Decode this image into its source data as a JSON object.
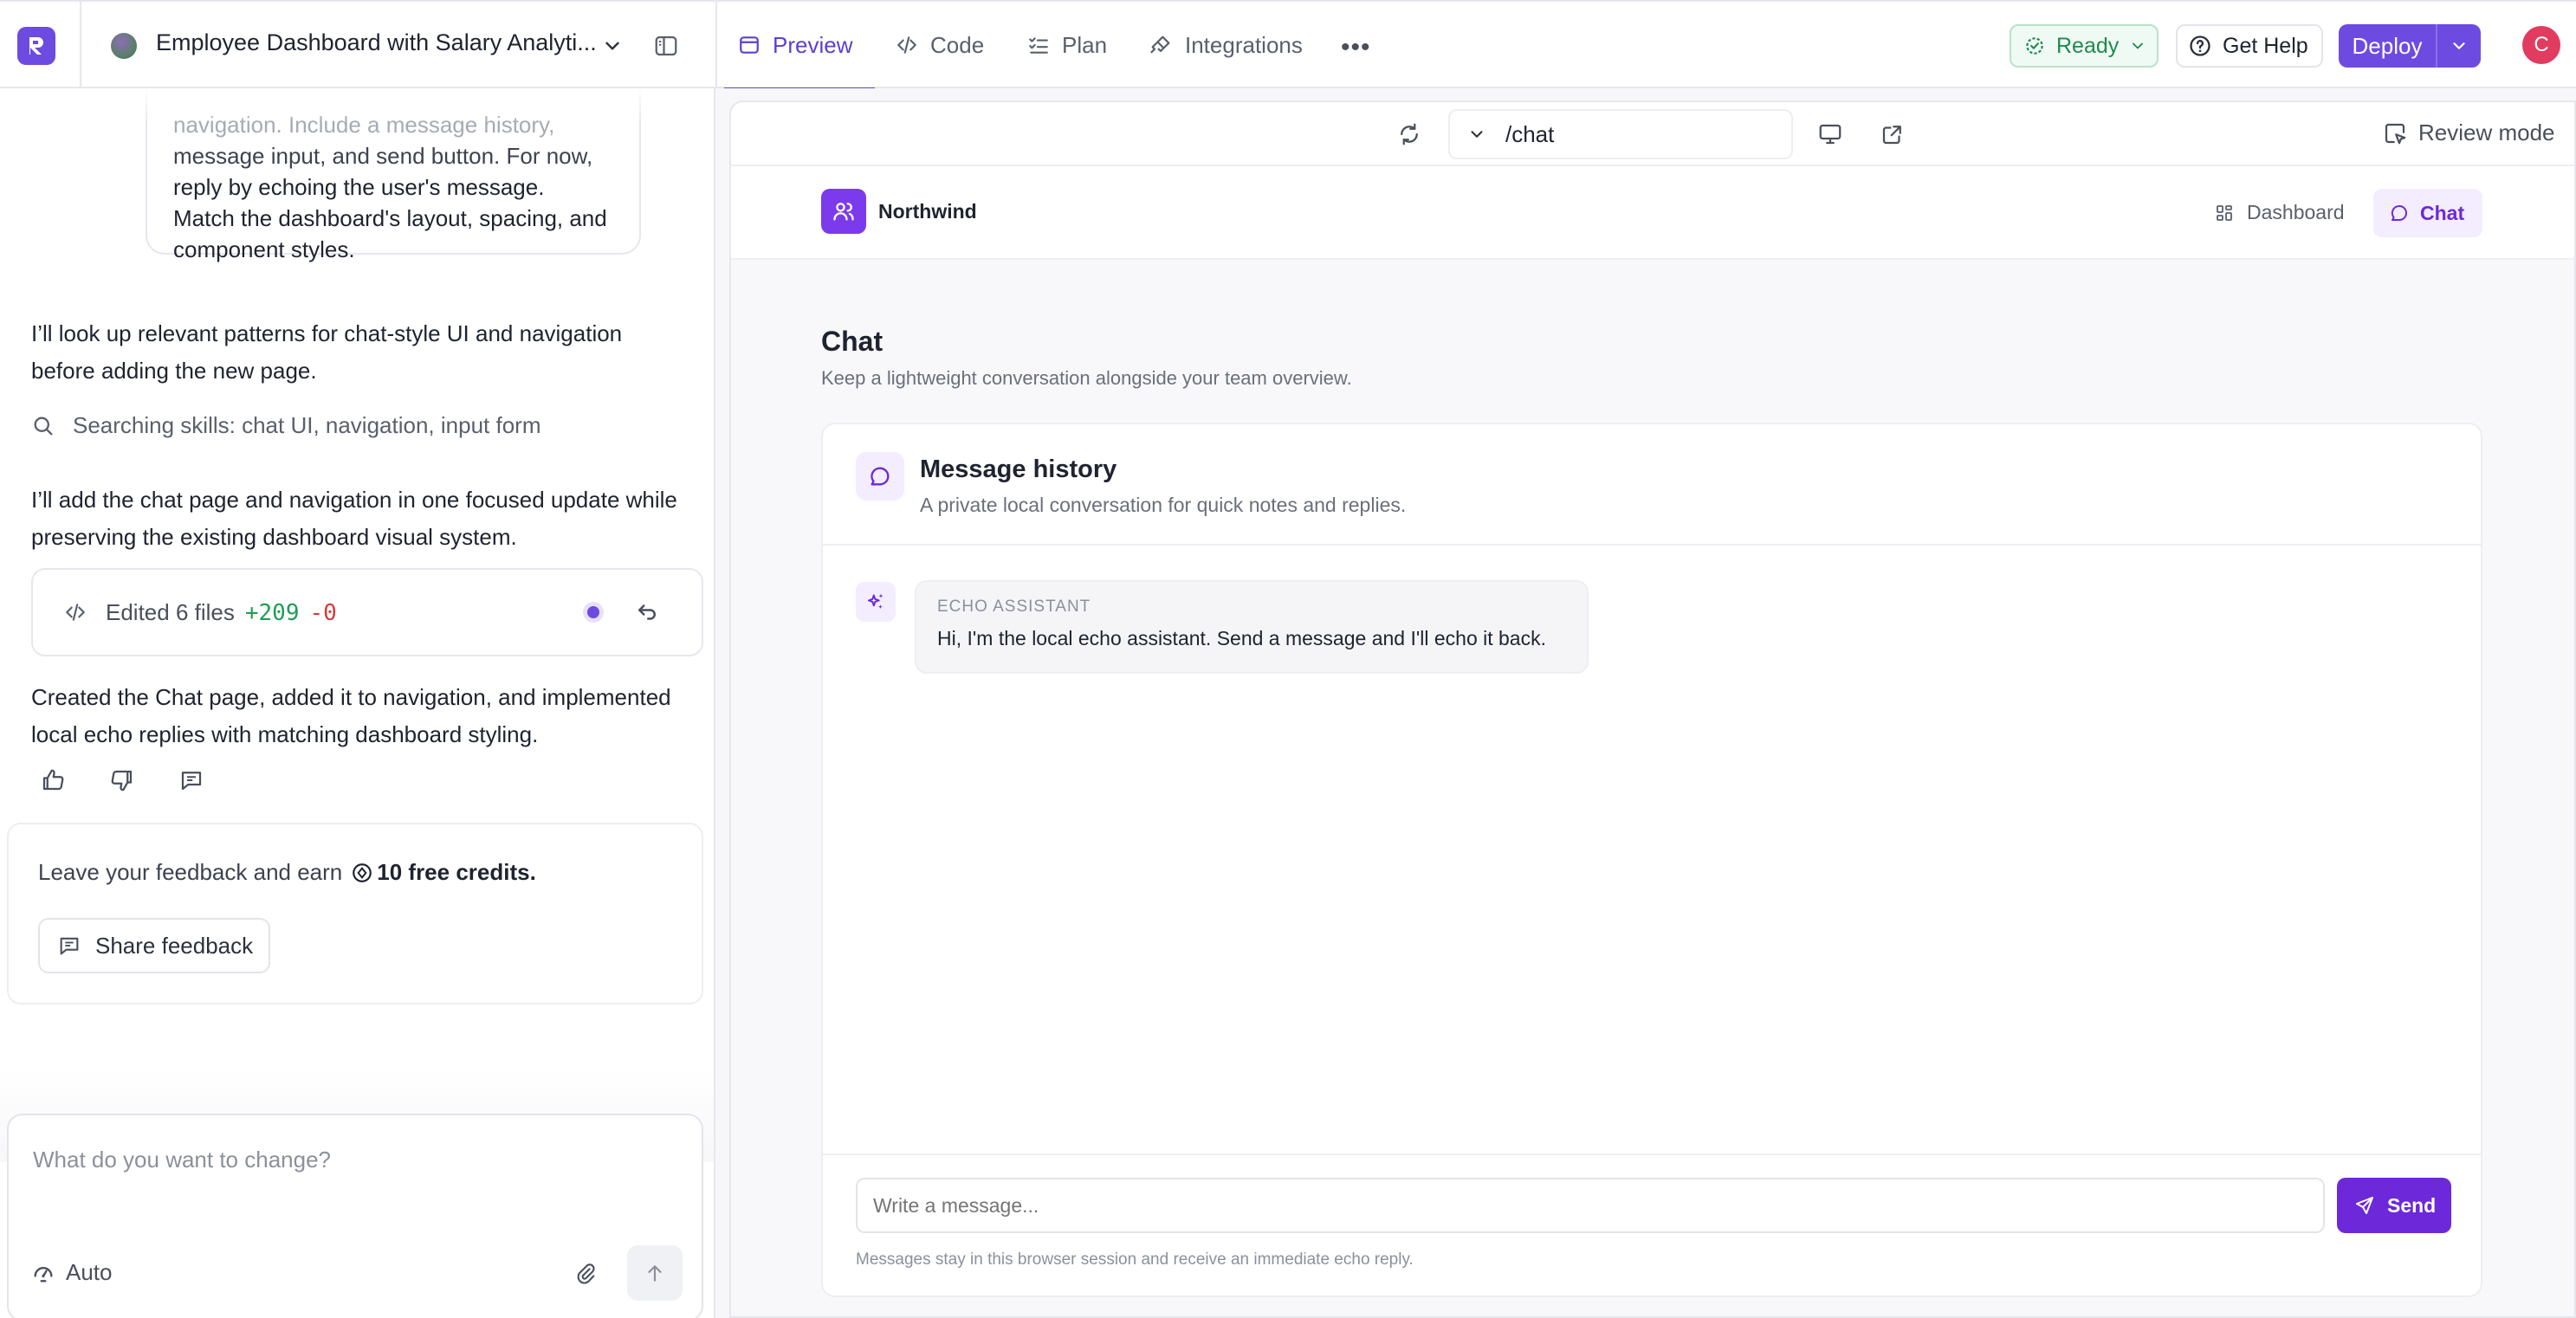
{
  "topbar": {
    "project_title": "Employee Dashboard with Salary Analyti...",
    "tabs": [
      {
        "label": "Preview",
        "icon": "browser-icon",
        "active": true
      },
      {
        "label": "Code",
        "icon": "code-icon"
      },
      {
        "label": "Plan",
        "icon": "checklist-icon"
      },
      {
        "label": "Integrations",
        "icon": "plug-icon"
      }
    ],
    "status_label": "Ready",
    "help_label": "Get Help",
    "deploy_label": "Deploy",
    "avatar_initial": "C"
  },
  "conversation": {
    "user_message_faded": "navigation. Include a message history,",
    "user_message_lines": [
      "message input, and send button. For now,",
      "reply by echoing the user's message.",
      "Match the dashboard's layout, spacing, and",
      "component styles."
    ],
    "assistant_msg_1": "I’ll look up relevant patterns for chat-style UI and navigation before adding the new page.",
    "search_status": "Searching skills: chat UI, navigation, input form",
    "assistant_msg_2": "I’ll add the chat page and navigation in one focused update while preserving the existing dashboard visual system.",
    "edit_summary": {
      "label": "Edited 6 files",
      "added": "+209",
      "removed": "-0"
    },
    "assistant_msg_3": "Created the Chat page, added it to navigation, and implemented local echo replies with matching dashboard styling."
  },
  "feedback": {
    "prompt": "Leave your feedback and earn",
    "credits": "10 free credits.",
    "share_label": "Share feedback"
  },
  "composer": {
    "placeholder": "What do you want to change?",
    "mode_label": "Auto"
  },
  "preview": {
    "url_path": "/chat",
    "review_mode_label": "Review mode",
    "app": {
      "brand": "Northwind",
      "nav": [
        {
          "label": "Dashboard",
          "active": false
        },
        {
          "label": "Chat",
          "active": true
        }
      ],
      "page_title": "Chat",
      "page_subtitle": "Keep a lightweight conversation alongside your team overview.",
      "card_title": "Message history",
      "card_subtitle": "A private local conversation for quick notes and replies.",
      "assistant_label": "ECHO ASSISTANT",
      "assistant_message": "Hi, I'm the local echo assistant. Send a message and I'll echo it back.",
      "input_placeholder": "Write a message...",
      "send_label": "Send",
      "footnote": "Messages stay in this browser session and receive an immediate echo reply."
    }
  },
  "colors": {
    "accent": "#6d4be0",
    "app_accent": "#6d28d9",
    "ready_green": "#1f8a4c",
    "diff_add": "#1f9d55",
    "diff_remove": "#d63a3a"
  }
}
